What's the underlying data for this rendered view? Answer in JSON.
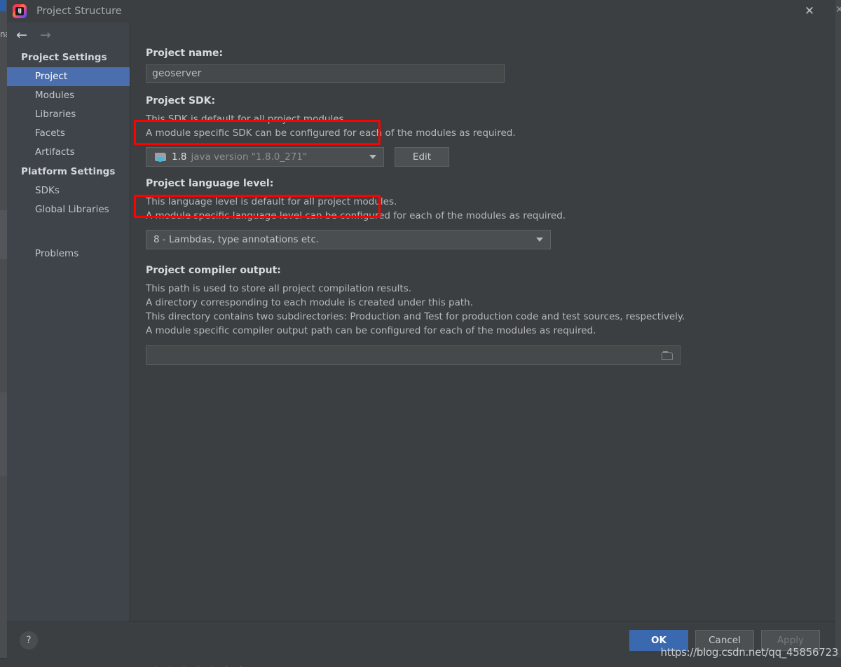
{
  "window": {
    "title": "Project Structure",
    "app_icon": "intellij-idea-icon",
    "icon_text": "IJ",
    "close_label": "✕",
    "background_window_label": "na"
  },
  "nav": {
    "back_label": "←",
    "forward_label": "→"
  },
  "sidebar": {
    "groups": [
      {
        "title": "Project Settings",
        "items": [
          {
            "label": "Project",
            "selected": true
          },
          {
            "label": "Modules",
            "selected": false
          },
          {
            "label": "Libraries",
            "selected": false
          },
          {
            "label": "Facets",
            "selected": false
          },
          {
            "label": "Artifacts",
            "selected": false
          }
        ]
      },
      {
        "title": "Platform Settings",
        "items": [
          {
            "label": "SDKs",
            "selected": false
          },
          {
            "label": "Global Libraries",
            "selected": false
          }
        ]
      }
    ],
    "extra_items": [
      {
        "label": "Problems",
        "selected": false
      }
    ]
  },
  "main": {
    "project_name": {
      "label": "Project name:",
      "value": "geoserver",
      "placeholder": ""
    },
    "project_sdk": {
      "label": "Project SDK:",
      "desc_line1": "This SDK is default for all project modules.",
      "desc_line2": "A module specific SDK can be configured for each of the modules as required.",
      "selected_version": "1.8",
      "selected_detail": "java version \"1.8.0_271\"",
      "sdk_icon": "java-sdk-folder-icon",
      "edit_button": "Edit"
    },
    "language_level": {
      "label": "Project language level:",
      "desc_line1": "This language level is default for all project modules.",
      "desc_line2": "A module specific language level can be configured for each of the modules as required.",
      "selected": "8 - Lambdas, type annotations etc."
    },
    "compiler_output": {
      "label": "Project compiler output:",
      "desc_line1": "This path is used to store all project compilation results.",
      "desc_line2": "A directory corresponding to each module is created under this path.",
      "desc_line3": "This directory contains two subdirectories: Production and Test for production code and test sources, respectively.",
      "desc_line4": "A module specific compiler output path can be configured for each of the modules as required.",
      "value": "",
      "placeholder": "",
      "browse_icon": "folder-browse-icon"
    }
  },
  "footer": {
    "help_label": "?",
    "buttons": [
      {
        "label": "OK",
        "style": "primary"
      },
      {
        "label": "Cancel",
        "style": "normal"
      },
      {
        "label": "Apply",
        "style": "disabled"
      }
    ]
  },
  "annotations": {
    "color": "#ff0000",
    "boxes": [
      {
        "name": "sdk-combo-highlight"
      },
      {
        "name": "language-level-highlight"
      }
    ]
  },
  "watermark": {
    "text": "https://blog.csdn.net/qq_45856723"
  }
}
